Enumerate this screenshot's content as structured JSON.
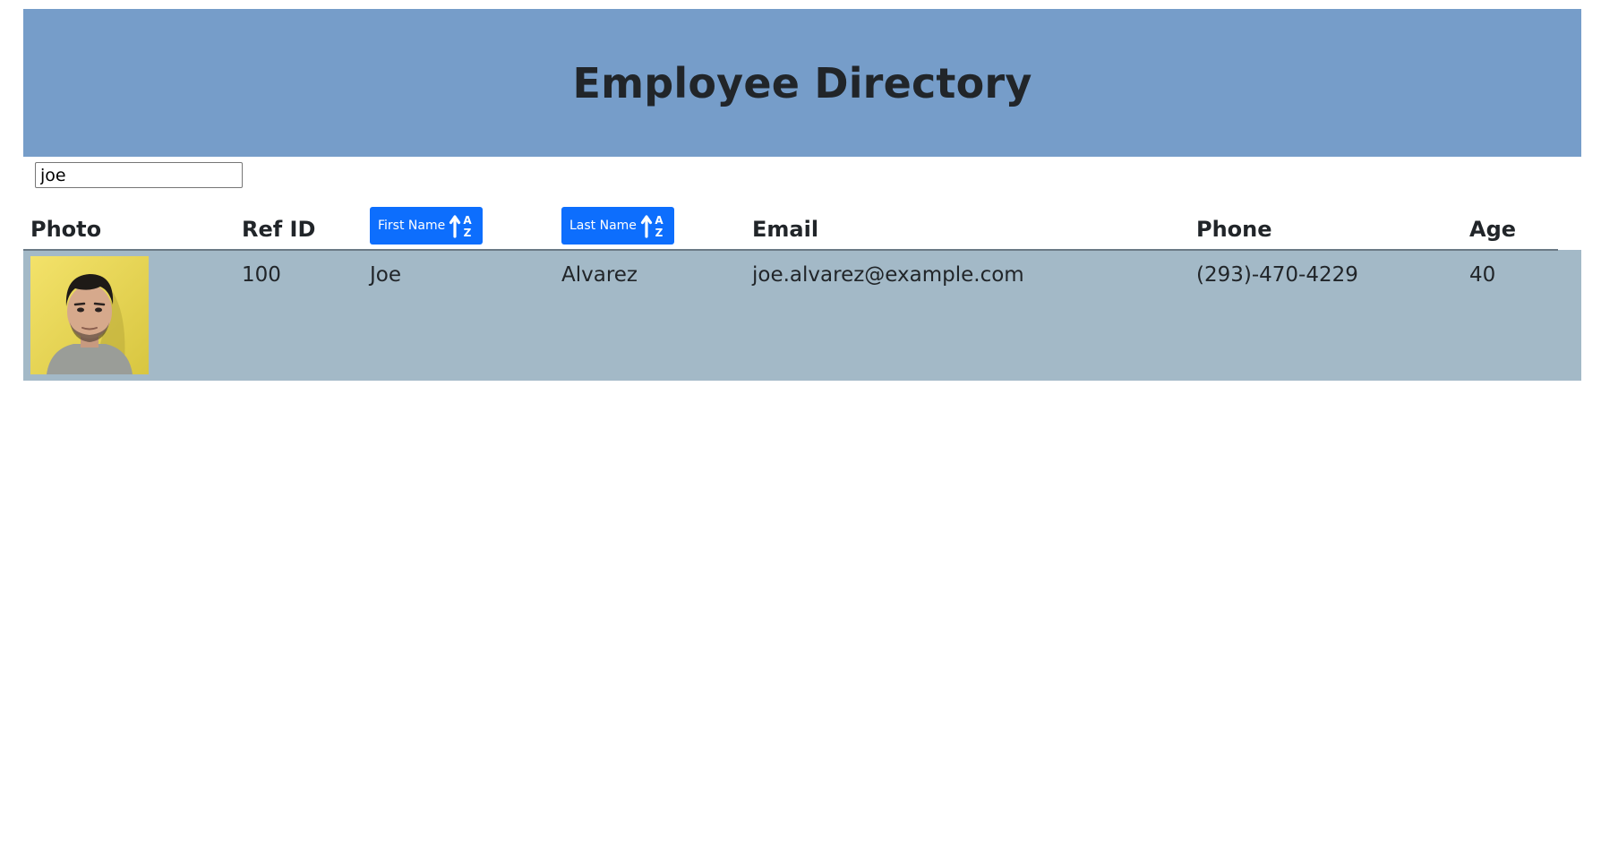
{
  "header": {
    "title": "Employee Directory"
  },
  "search": {
    "value": "joe"
  },
  "table": {
    "columns": {
      "photo": "Photo",
      "ref_id": "Ref ID",
      "first_name": "First Name",
      "last_name": "Last Name",
      "email": "Email",
      "phone": "Phone",
      "age": "Age"
    },
    "sort_icon": "sort-alpha-up-icon",
    "rows": [
      {
        "photo": "avatar-photo",
        "ref_id": "100",
        "first_name": "Joe",
        "last_name": "Alvarez",
        "email": "joe.alvarez@example.com",
        "phone": "(293)-470-4229",
        "age": "40"
      }
    ]
  },
  "colors": {
    "header_bg": "#769dc9",
    "row_bg": "#a3b9c7",
    "button_bg": "#0d6efd"
  }
}
